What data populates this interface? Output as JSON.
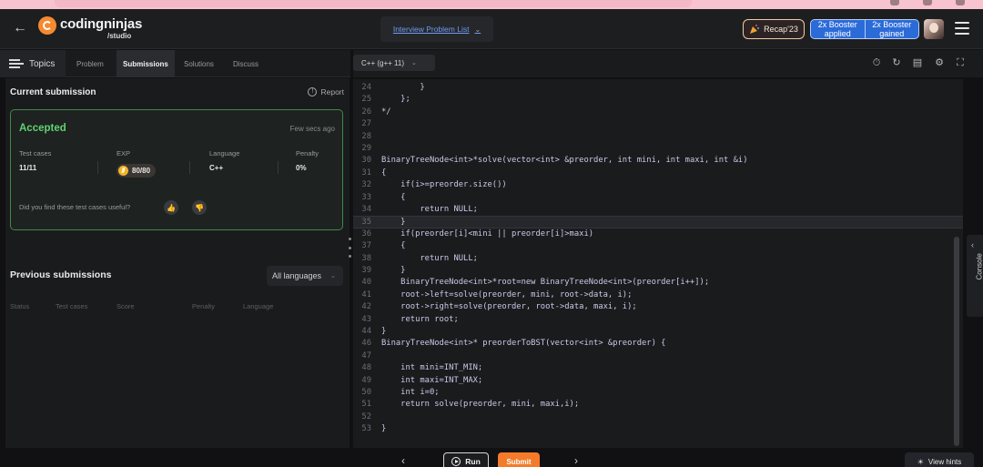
{
  "header": {
    "logo_text": "codingninjas",
    "logo_sub": "/studio",
    "problem_list": "Interview Problem List",
    "recap": "Recap'23",
    "booster_1": "2x Booster applied",
    "booster_2": "2x Booster gained"
  },
  "left_tabs": {
    "topics": "Topics",
    "problem": "Problem",
    "submissions": "Submissions",
    "solutions": "Solutions",
    "discuss": "Discuss"
  },
  "current_submission": {
    "title": "Current submission",
    "report": "Report",
    "status": "Accepted",
    "time": "Few secs ago",
    "stats": {
      "test_cases_label": "Test cases",
      "test_cases_value": "11/11",
      "exp_label": "EXP",
      "exp_value": "80/80",
      "language_label": "Language",
      "language_value": "C++",
      "penalty_label": "Penalty",
      "penalty_value": "0%"
    },
    "useful_question": "Did you find these test cases useful?"
  },
  "previous_submissions": {
    "title": "Previous submissions",
    "filter": "All languages",
    "columns": [
      "Status",
      "Test cases",
      "Score",
      "Penalty",
      "Language"
    ]
  },
  "editor": {
    "language": "C++ (g++ 11)",
    "console_label": "Console",
    "lines": [
      {
        "n": "24",
        "text": "        }"
      },
      {
        "n": "25",
        "text": "    };"
      },
      {
        "n": "26",
        "text": "*/"
      },
      {
        "n": "27",
        "text": ""
      },
      {
        "n": "28",
        "text": ""
      },
      {
        "n": "29",
        "text": ""
      },
      {
        "n": "30",
        "text": "BinaryTreeNode<int>*solve(vector<int> &preorder, int mini, int maxi, int &i)"
      },
      {
        "n": "31",
        "text": "{"
      },
      {
        "n": "32",
        "text": "    if(i>=preorder.size())"
      },
      {
        "n": "33",
        "text": "    {"
      },
      {
        "n": "34",
        "text": "        return NULL;"
      },
      {
        "n": "35",
        "text": "    }"
      },
      {
        "n": "36",
        "text": "    if(preorder[i]<mini || preorder[i]>maxi)"
      },
      {
        "n": "37",
        "text": "    {"
      },
      {
        "n": "38",
        "text": "        return NULL;"
      },
      {
        "n": "39",
        "text": "    }"
      },
      {
        "n": "40",
        "text": "    BinaryTreeNode<int>*root=new BinaryTreeNode<int>(preorder[i++]);"
      },
      {
        "n": "41",
        "text": "    root->left=solve(preorder, mini, root->data, i);"
      },
      {
        "n": "42",
        "text": "    root->right=solve(preorder, root->data, maxi, i);"
      },
      {
        "n": "43",
        "text": "    return root;"
      },
      {
        "n": "44",
        "text": "}"
      },
      {
        "n": "46",
        "text": "BinaryTreeNode<int>* preorderToBST(vector<int> &preorder) {"
      },
      {
        "n": "47",
        "text": ""
      },
      {
        "n": "48",
        "text": "    int mini=INT_MIN;"
      },
      {
        "n": "49",
        "text": "    int maxi=INT_MAX;"
      },
      {
        "n": "50",
        "text": "    int i=0;"
      },
      {
        "n": "51",
        "text": "    return solve(preorder, mini, maxi,i);"
      },
      {
        "n": "52",
        "text": ""
      },
      {
        "n": "53",
        "text": "}"
      }
    ]
  },
  "bottom": {
    "run": "Run",
    "submit": "Submit",
    "hints": "View hints"
  }
}
